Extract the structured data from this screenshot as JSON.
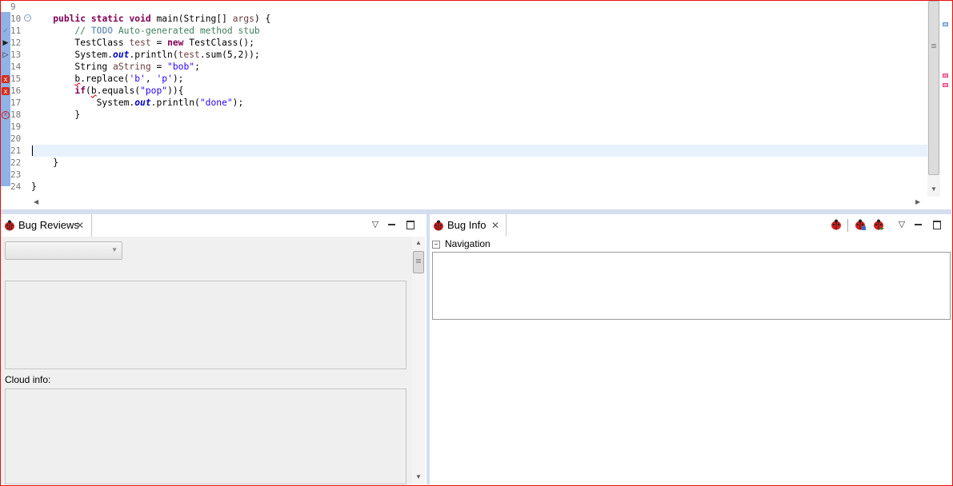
{
  "editor": {
    "line_numbers": [
      "9",
      "10",
      "11",
      "12",
      "13",
      "14",
      "15",
      "16",
      "17",
      "18",
      "19",
      "20",
      "21",
      "22",
      "23",
      "24"
    ],
    "lines": [
      [],
      [
        {
          "t": "    "
        },
        {
          "t": "public",
          "c": "kw"
        },
        {
          "t": " "
        },
        {
          "t": "static",
          "c": "kw"
        },
        {
          "t": " "
        },
        {
          "t": "void",
          "c": "kw"
        },
        {
          "t": " main(String[] "
        },
        {
          "t": "args",
          "c": "prm"
        },
        {
          "t": ") {"
        }
      ],
      [
        {
          "t": "        "
        },
        {
          "t": "// ",
          "c": "cm"
        },
        {
          "t": "TODO",
          "c": "cmk"
        },
        {
          "t": " Auto-generated method stub",
          "c": "cm"
        }
      ],
      [
        {
          "t": "        TestClass "
        },
        {
          "t": "test",
          "c": "prm"
        },
        {
          "t": " = "
        },
        {
          "t": "new",
          "c": "kw"
        },
        {
          "t": " TestClass();"
        }
      ],
      [
        {
          "t": "        System."
        },
        {
          "t": "out",
          "c": "fld"
        },
        {
          "t": ".println("
        },
        {
          "t": "test",
          "c": "prm"
        },
        {
          "t": ".sum(5,2));"
        }
      ],
      [
        {
          "t": "        String "
        },
        {
          "t": "aString",
          "c": "prm"
        },
        {
          "t": " = "
        },
        {
          "t": "\"bob\"",
          "c": "st"
        },
        {
          "t": ";"
        }
      ],
      [
        {
          "t": "        "
        },
        {
          "t": "b",
          "c": "err"
        },
        {
          "t": ".replace("
        },
        {
          "t": "'b'",
          "c": "st"
        },
        {
          "t": ", "
        },
        {
          "t": "'p'",
          "c": "st"
        },
        {
          "t": ");"
        }
      ],
      [
        {
          "t": "        "
        },
        {
          "t": "if",
          "c": "kw"
        },
        {
          "t": "("
        },
        {
          "t": "b",
          "c": "err"
        },
        {
          "t": ".equals("
        },
        {
          "t": "\"pop\"",
          "c": "st"
        },
        {
          "t": ")){"
        }
      ],
      [
        {
          "t": "            System."
        },
        {
          "t": "out",
          "c": "fld"
        },
        {
          "t": ".println("
        },
        {
          "t": "\"done\"",
          "c": "st"
        },
        {
          "t": ");"
        }
      ],
      [
        {
          "t": "        }"
        }
      ],
      [],
      [],
      [],
      [
        {
          "t": "    }"
        }
      ],
      [],
      [
        {
          "t": "}"
        }
      ]
    ],
    "colors": {
      "current_line": "#e8f2fe",
      "ruler_selection": "#8fb3e6",
      "error_marker": "#e04080"
    }
  },
  "bug_reviews": {
    "tab_label": "Bug Reviews",
    "combo_value": "",
    "cloud_info_label": "Cloud info:"
  },
  "bug_info": {
    "tab_label": "Bug Info",
    "navigation_label": "Navigation"
  },
  "icons": {
    "bug": "ladybug-icon",
    "close": "close-icon",
    "view_menu": "view-menu-icon",
    "minimize": "minimize-icon",
    "maximize": "maximize-icon"
  }
}
